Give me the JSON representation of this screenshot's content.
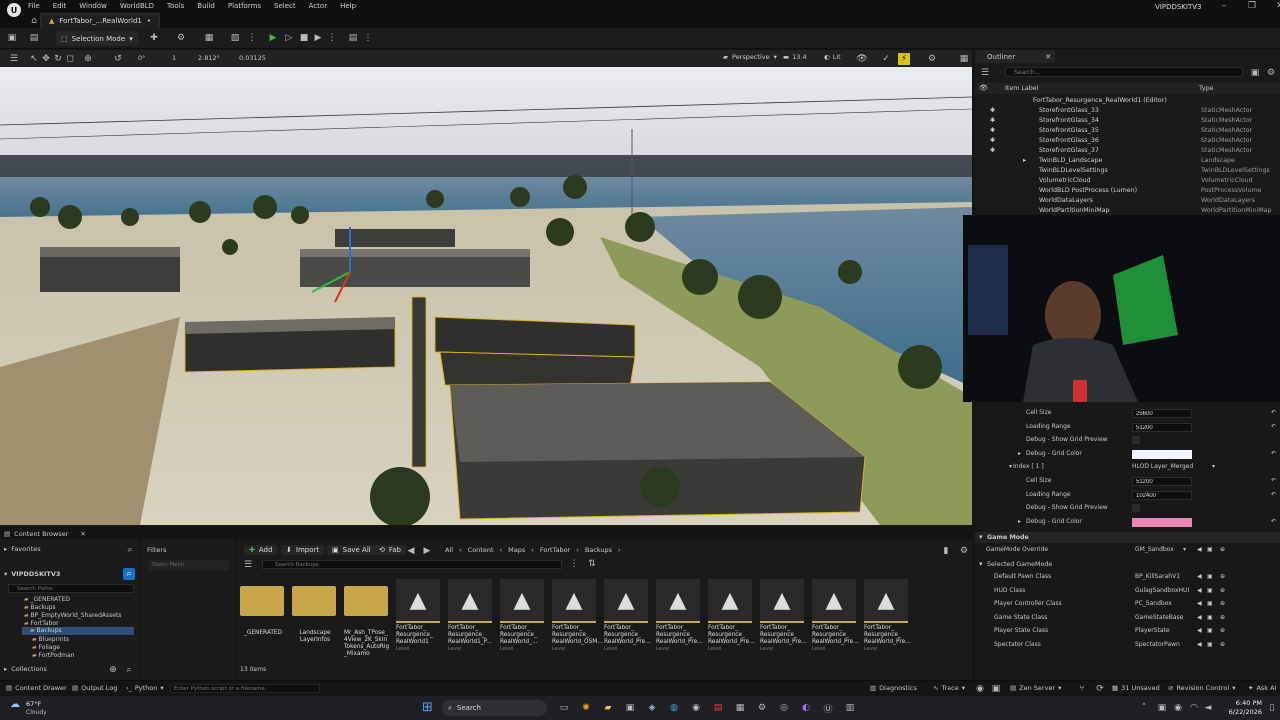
{
  "menu": [
    "File",
    "Edit",
    "Window",
    "WorldBLD",
    "Tools",
    "Build",
    "Platforms",
    "Select",
    "Actor",
    "Help"
  ],
  "map_tab": {
    "label": "FortTabor_...RealWorld1",
    "modified": "•"
  },
  "window_title": "VIPDDSKITV3",
  "toolbar": {
    "selection_mode": "Selection Mode"
  },
  "viewport_toolbar": {
    "rotation_snap": "0°",
    "scale_snap": "1",
    "grid_value": "2.812°",
    "scale_value": "0.03125",
    "view_mode": "Perspective",
    "fov": "13.4",
    "lit": "Lit"
  },
  "outliner": {
    "tab": "Outliner",
    "search_placeholder": "Search...",
    "col_label": "Item Label",
    "col_type": "Type",
    "items": [
      {
        "label": "FortTabor_Resurgence_RealWorld1 (Editor)",
        "type": ""
      },
      {
        "label": "StorefrontGlass_33",
        "type": "StaticMeshActor"
      },
      {
        "label": "StorefrontGlass_34",
        "type": "StaticMeshActor"
      },
      {
        "label": "StorefrontGlass_35",
        "type": "StaticMeshActor"
      },
      {
        "label": "StorefrontGlass_36",
        "type": "StaticMeshActor"
      },
      {
        "label": "StorefrontGlass_37",
        "type": "StaticMeshActor"
      },
      {
        "label": "TwinBLD_Landscape",
        "type": "Landscape"
      },
      {
        "label": "TwinBLDLevelSettings",
        "type": "TwinBLDLevelSettings"
      },
      {
        "label": "VolumetricCloud",
        "type": "VolumetricCloud"
      },
      {
        "label": "WorldBLD PostProcess (Lumen)",
        "type": "PostProcessVolume"
      },
      {
        "label": "WorldDataLayers",
        "type": "WorldDataLayers"
      },
      {
        "label": "WorldPartitionMiniMap",
        "type": "WorldPartitionMiniMap"
      }
    ]
  },
  "details": {
    "grid0": {
      "cell_size_label": "Cell Size",
      "cell_size": "25600",
      "loading_label": "Loading Range",
      "loading": "51200",
      "show_grid": "Debug - Show Grid Preview",
      "grid_color": "Debug - Grid Color"
    },
    "index_label": "Index [ 1 ]",
    "index_value": "HLOD Layer_Merged",
    "grid1": {
      "cell_size_label": "Cell Size",
      "cell_size": "51200",
      "loading_label": "Loading Range",
      "loading": "102400",
      "show_grid": "Debug - Show Grid Preview",
      "grid_color": "Debug - Grid Color"
    },
    "colors": {
      "grid0": "#f0f4ff",
      "grid1": "#e887b4"
    },
    "game_mode_header": "Game Mode",
    "gamemode_override_label": "GameMode Override",
    "gamemode_override": "GM_Sandbox",
    "selected_header": "Selected GameMode",
    "rows": [
      {
        "label": "Default Pawn Class",
        "value": "BP_KillSarahV1"
      },
      {
        "label": "HUD Class",
        "value": "GulagSandboxHUI"
      },
      {
        "label": "Player Controller Class",
        "value": "PC_Sandbox"
      },
      {
        "label": "Game State Class",
        "value": "GameStateBase"
      },
      {
        "label": "Player State Class",
        "value": "PlayerState"
      },
      {
        "label": "Spectator Class",
        "value": "SpectatorPawn"
      }
    ]
  },
  "content_browser": {
    "tab": "Content Browser",
    "favorites": "Favorites",
    "project": "VIPDDSKITV3",
    "search_paths_placeholder": "Search Paths",
    "tree": [
      "_GENERATED",
      "Backups",
      "BP_EmptyWorld_SharedAssets",
      "FortTabor",
      "Backups",
      "Blueprints",
      "Foliage",
      "FortPodman"
    ],
    "collections": "Collections",
    "filters": "Filters",
    "filter_chip": "Static Mesh",
    "add": "Add",
    "import": "Import",
    "save_all": "Save All",
    "fab": "Fab",
    "breadcrumb": [
      "All",
      "Content",
      "Maps",
      "FortTabor",
      "Backups"
    ],
    "search_placeholder": "Search Backups",
    "folders": [
      {
        "label": "_GENERATED"
      },
      {
        "label": "Landscape\nLayerInfos"
      },
      {
        "label": "Mr_Ash_TPose_\n4View_2K_Skin\nTokens_AutoRig\n_Mixamo"
      }
    ],
    "assets": [
      {
        "label": "FortTabor_\nResurgence_\nRealWorld1",
        "sub": "Level"
      },
      {
        "label": "FortTabor_\nResurgence_\nRealWorld1_P...",
        "sub": "Level"
      },
      {
        "label": "FortTabor_\nResurgence_\nRealWorld_...",
        "sub": "Level"
      },
      {
        "label": "FortTabor_\nResurgence_\nRealWorld_OSM...",
        "sub": "Level"
      },
      {
        "label": "FortTabor_\nResurgence_\nRealWorld_Pre...",
        "sub": "Level"
      },
      {
        "label": "FortTabor_\nResurgence_\nRealWorld_Pre...",
        "sub": "Level"
      },
      {
        "label": "FortTabor_\nResurgence_\nRealWorld_Pre...",
        "sub": "Level"
      },
      {
        "label": "FortTabor_\nResurgence_\nRealWorld_Pre...",
        "sub": "Level"
      },
      {
        "label": "FortTabor_\nResurgence_\nRealWorld_Pre...",
        "sub": "Level"
      },
      {
        "label": "FortTabor_\nResurgence_\nRealWorld_Pre...",
        "sub": "Level"
      }
    ],
    "item_count": "13 items"
  },
  "statusbar": {
    "content_drawer": "Content Drawer",
    "output_log": "Output Log",
    "python": "Python",
    "cmd_placeholder": "Enter Python script or a filename",
    "diagnostics": "Diagnostics",
    "trace": "Trace",
    "zen": "Zen Server",
    "unsaved": "31 Unsaved",
    "revision": "Revision Control",
    "ask": "Ask AI"
  },
  "taskbar": {
    "temp": "67°F",
    "weather": "Cloudy",
    "search": "Search",
    "time": "6:40 PM",
    "date": "6/22/2026"
  }
}
